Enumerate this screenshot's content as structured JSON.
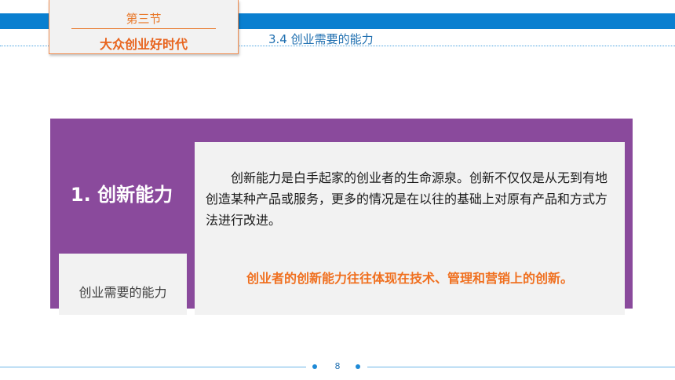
{
  "header": {
    "section_no": "第三节",
    "section_title": "大众创业好时代",
    "subtitle": "3.4  创业需要的能力"
  },
  "main": {
    "point_title": "1. 创新能力",
    "tag_label": "创业需要的能力",
    "paragraph": "创新能力是白手起家的创业者的生命源泉。创新不仅仅是从无到有地创造某种产品或服务，更多的情况是在以往的基础上对原有产品和方式方法进行改进。",
    "highlight": "创业者的创新能力往往体现在技术、管理和营销上的创新。"
  },
  "footer": {
    "page_number": "8"
  },
  "colors": {
    "brand_blue": "#0a7fd0",
    "accent_orange": "#f07020",
    "panel_purple": "#8a4a9c",
    "box_gray": "#f2f2f2"
  }
}
